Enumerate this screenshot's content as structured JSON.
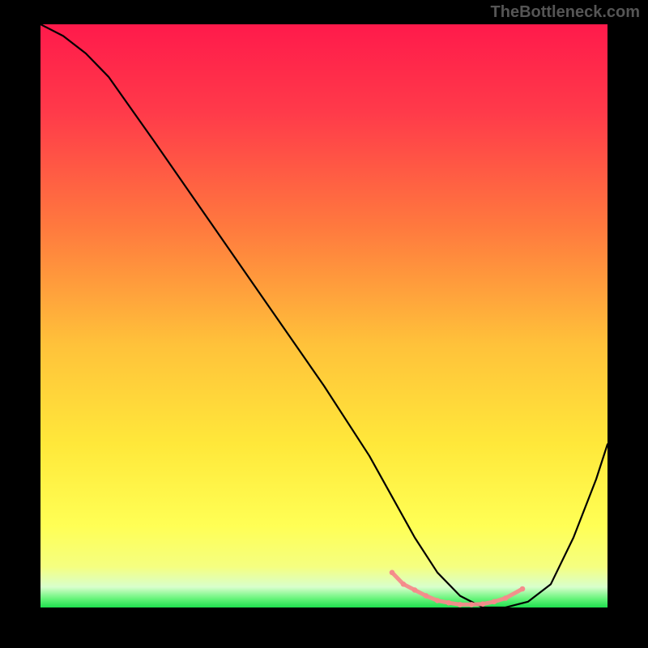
{
  "watermark": "TheBottleneck.com",
  "chart_data": {
    "type": "line",
    "title": "",
    "xlabel": "",
    "ylabel": "",
    "xlim": [
      0,
      100
    ],
    "ylim": [
      0,
      100
    ],
    "gradient_stops": [
      {
        "offset": 0.0,
        "color": "#ff1a4b"
      },
      {
        "offset": 0.15,
        "color": "#ff3a4a"
      },
      {
        "offset": 0.35,
        "color": "#ff7a3e"
      },
      {
        "offset": 0.55,
        "color": "#ffc23a"
      },
      {
        "offset": 0.72,
        "color": "#ffe83a"
      },
      {
        "offset": 0.86,
        "color": "#ffff55"
      },
      {
        "offset": 0.93,
        "color": "#f5ff80"
      },
      {
        "offset": 0.965,
        "color": "#d8ffcc"
      },
      {
        "offset": 0.985,
        "color": "#66f47a"
      },
      {
        "offset": 1.0,
        "color": "#1ee04f"
      }
    ],
    "series": [
      {
        "name": "bottleneck-curve",
        "x": [
          0,
          4,
          8,
          12,
          20,
          30,
          40,
          50,
          58,
          62,
          66,
          70,
          74,
          78,
          82,
          86,
          90,
          94,
          98,
          100
        ],
        "y": [
          100,
          98,
          95,
          91,
          80,
          66,
          52,
          38,
          26,
          19,
          12,
          6,
          2,
          0,
          0,
          1,
          4,
          12,
          22,
          28
        ]
      }
    ],
    "trough_markers": {
      "name": "optimal-zone",
      "color": "#f58b8b",
      "radius": 3.3,
      "x": [
        62,
        64,
        66,
        68,
        70,
        72,
        74,
        76,
        78,
        80,
        82,
        85
      ],
      "y": [
        6,
        4,
        3,
        2,
        1.2,
        0.8,
        0.5,
        0.5,
        0.6,
        1.0,
        1.6,
        3.2
      ]
    }
  }
}
